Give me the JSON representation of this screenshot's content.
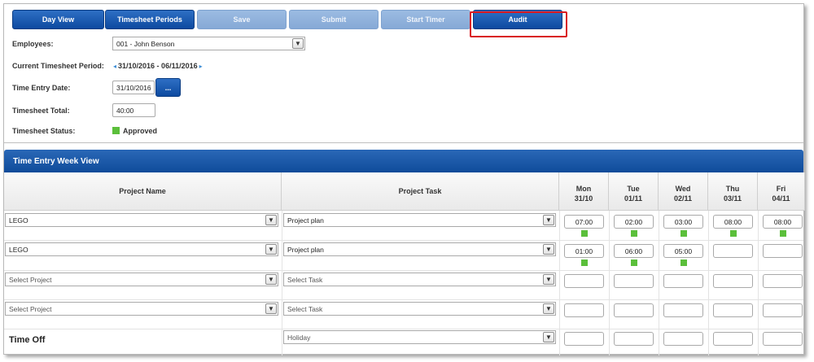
{
  "toolbar": {
    "day_view": "Day View",
    "timesheet_periods": "Timesheet Periods",
    "save": "Save",
    "submit": "Submit",
    "start_timer": "Start Timer",
    "audit": "Audit"
  },
  "form": {
    "employees_label": "Employees:",
    "employee_selected": "001 - John Benson",
    "period_label": "Current Timesheet Period:",
    "period_value": "31/10/2016 - 06/11/2016",
    "entry_date_label": "Time Entry Date:",
    "entry_date_value": "31/10/2016",
    "date_button": "...",
    "total_label": "Timesheet Total:",
    "total_value": "40:00",
    "status_label": "Timesheet Status:",
    "status_value": "Approved",
    "status_color": "#5bbf3b"
  },
  "week": {
    "title": "Time Entry Week View",
    "col_project": "Project Name",
    "col_task": "Project Task",
    "days": [
      {
        "day": "Mon",
        "date": "31/10"
      },
      {
        "day": "Tue",
        "date": "01/11"
      },
      {
        "day": "Wed",
        "date": "02/11"
      },
      {
        "day": "Thu",
        "date": "03/11"
      },
      {
        "day": "Fri",
        "date": "04/11"
      }
    ],
    "rows": [
      {
        "project": "LEGO",
        "task": "Project plan",
        "times": [
          "07:00",
          "02:00",
          "03:00",
          "08:00",
          "08:00"
        ],
        "marks": [
          true,
          true,
          true,
          true,
          true
        ]
      },
      {
        "project": "LEGO",
        "task": "Project plan",
        "times": [
          "01:00",
          "06:00",
          "05:00",
          "",
          ""
        ],
        "marks": [
          true,
          true,
          true,
          false,
          false
        ]
      },
      {
        "project": "Select Project",
        "task": "Select Task",
        "times": [
          "",
          "",
          "",
          "",
          ""
        ],
        "marks": [
          false,
          false,
          false,
          false,
          false
        ]
      },
      {
        "project": "Select Project",
        "task": "Select Task",
        "times": [
          "",
          "",
          "",
          "",
          ""
        ],
        "marks": [
          false,
          false,
          false,
          false,
          false
        ]
      }
    ],
    "time_off_label": "Time Off",
    "time_off_type": "Holiday",
    "time_off_times": [
      "",
      "",
      "",
      "",
      ""
    ]
  }
}
